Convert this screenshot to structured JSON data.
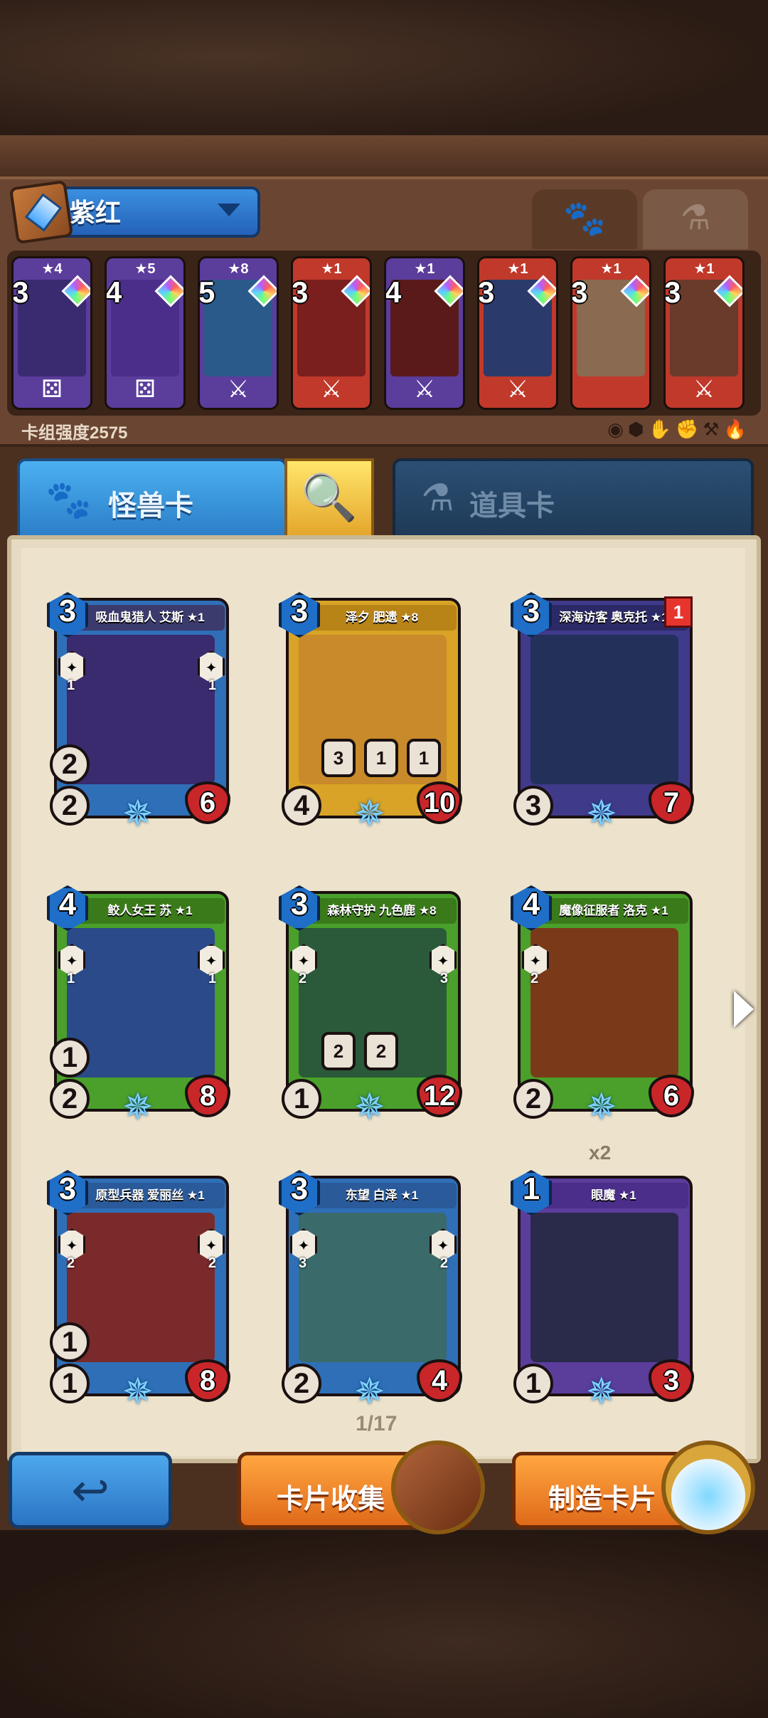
{
  "deck": {
    "name": "紫红",
    "strength": "卡组强度2575",
    "slots": [
      {
        "stars": "★4",
        "cost": "3",
        "color": "#5b3d9c",
        "art": "#3a2a70",
        "bottom": "⚄"
      },
      {
        "stars": "★5",
        "cost": "4",
        "color": "#5b3d9c",
        "art": "#4a2e8a",
        "bottom": "⚄"
      },
      {
        "stars": "★8",
        "cost": "5",
        "color": "#5b3d9c",
        "art": "#2a5a8a",
        "bottom": "⚔"
      },
      {
        "stars": "★1",
        "cost": "3",
        "color": "#c0392b",
        "art": "#7a1e1e",
        "bottom": "⚔"
      },
      {
        "stars": "★1",
        "cost": "4",
        "color": "#5b3d9c",
        "art": "#5a1a1a",
        "bottom": "⚔"
      },
      {
        "stars": "★1",
        "cost": "3",
        "color": "#c0392b",
        "art": "#2a3a6a",
        "bottom": "⚔"
      },
      {
        "stars": "★1",
        "cost": "3",
        "color": "#c0392b",
        "art": "#8a6a50",
        "bottom": ""
      },
      {
        "stars": "★1",
        "cost": "3",
        "color": "#c0392b",
        "art": "#6a3a2a",
        "bottom": "⚔"
      }
    ],
    "filters": [
      "◉",
      "⬢",
      "✋",
      "✊",
      "⚒",
      "🔥"
    ]
  },
  "tabs": {
    "monster_label": "怪兽卡",
    "item_label": "道具卡"
  },
  "cards": [
    {
      "name": "吸血鬼猎人 艾斯 ★1",
      "cost": "3",
      "atk": "2",
      "atk_top": "2",
      "hp": "6",
      "frame": "#2f6fb8",
      "bar": "#3b3b6e",
      "art": "#3a2a6e",
      "ab_left": "1",
      "ab_right": "1"
    },
    {
      "name": "泽夕 肥遗 ★8",
      "cost": "3",
      "atk": "4",
      "atk_top": "",
      "hp": "10",
      "frame": "#d8a326",
      "bar": "#b88418",
      "art": "#c88a2a",
      "ab_left": "",
      "ab_right": "",
      "extra": [
        "3",
        "1",
        "1"
      ]
    },
    {
      "name": "深海访客 奥克托 ★1",
      "cost": "3",
      "atk": "3",
      "atk_top": "",
      "hp": "7",
      "frame": "#3f3a8a",
      "bar": "#2c2a66",
      "art": "#23305a",
      "ab_left": "",
      "ab_right": "",
      "badge": "1"
    },
    {
      "name": "鲛人女王 苏 ★1",
      "cost": "4",
      "atk": "2",
      "atk_top": "1",
      "hp": "8",
      "frame": "#4aa02a",
      "bar": "#3a7a1a",
      "art": "#2a4a8a",
      "ab_left": "1",
      "ab_right": "1"
    },
    {
      "name": "森林守护 九色鹿 ★8",
      "cost": "3",
      "atk": "1",
      "atk_top": "",
      "hp": "12",
      "frame": "#4aa02a",
      "bar": "#3a7a1a",
      "art": "#2a5a3a",
      "ab_left": "2",
      "ab_right": "3",
      "extra": [
        "2",
        "2"
      ]
    },
    {
      "name": "魔像征服者 洛克 ★1",
      "cost": "4",
      "atk": "2",
      "atk_top": "",
      "hp": "6",
      "frame": "#4aa02a",
      "bar": "#3a7a1a",
      "art": "#7a3a1a",
      "ab_left": "2",
      "ab_right": ""
    },
    {
      "name": "原型兵器 爱丽丝 ★1",
      "cost": "3",
      "atk": "1",
      "atk_top": "1",
      "hp": "8",
      "frame": "#2f6fb8",
      "bar": "#2a5a9a",
      "art": "#7a2a2a",
      "ab_left": "2",
      "ab_right": "2"
    },
    {
      "name": "东望 白泽 ★1",
      "cost": "3",
      "atk": "2",
      "atk_top": "",
      "hp": "4",
      "frame": "#2f6fb8",
      "bar": "#2a5a9a",
      "art": "#3a6a6a",
      "ab_left": "3",
      "ab_right": "2"
    },
    {
      "name": "眼魔 ★1",
      "cost": "1",
      "atk": "1",
      "atk_top": "",
      "hp": "3",
      "frame": "#5b3d9c",
      "bar": "#4a2e8a",
      "art": "#2a2a4a",
      "ab_left": "",
      "ab_right": "",
      "copies": "x2"
    }
  ],
  "pager": {
    "indicator": "1/17"
  },
  "buttons": {
    "collect_label": "卡片收集",
    "craft_label": "制造卡片"
  }
}
